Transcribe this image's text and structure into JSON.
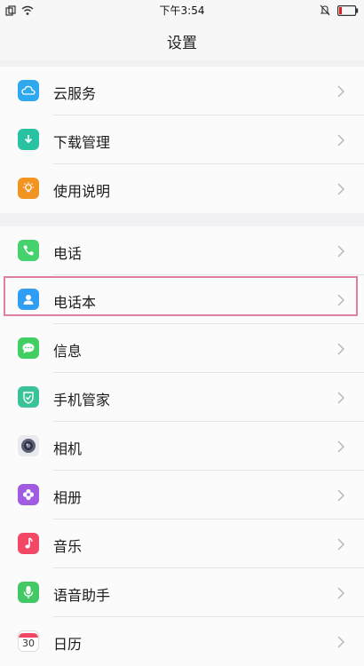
{
  "status": {
    "time": "下午3:54"
  },
  "header": {
    "title": "设置"
  },
  "section1": [
    {
      "label": "云服务",
      "icon": "cloud-icon",
      "color": "#2ea8ef"
    },
    {
      "label": "下载管理",
      "icon": "download-icon",
      "color": "#29c3a3"
    },
    {
      "label": "使用说明",
      "icon": "lightbulb-icon",
      "color": "#f29422"
    }
  ],
  "section2": [
    {
      "label": "电话",
      "icon": "phone-icon",
      "color": "#45d16b"
    },
    {
      "label": "电话本",
      "icon": "contact-icon",
      "color": "#2f9ef3"
    },
    {
      "label": "信息",
      "icon": "message-icon",
      "color": "#41cf62"
    },
    {
      "label": "手机管家",
      "icon": "shield-icon",
      "color": "#3ac29a"
    },
    {
      "label": "相机",
      "icon": "camera-icon",
      "color": "#5a5f73"
    },
    {
      "label": "相册",
      "icon": "flower-icon",
      "color": "#a05be0"
    },
    {
      "label": "音乐",
      "icon": "music-icon",
      "color": "#f24866"
    },
    {
      "label": "语音助手",
      "icon": "microphone-icon",
      "color": "#44c865"
    },
    {
      "label": "日历",
      "icon": "calendar-icon",
      "color": "#ffffff"
    }
  ],
  "calendar_icon": {
    "day": "30"
  },
  "highlight_color": "#e07ea6"
}
